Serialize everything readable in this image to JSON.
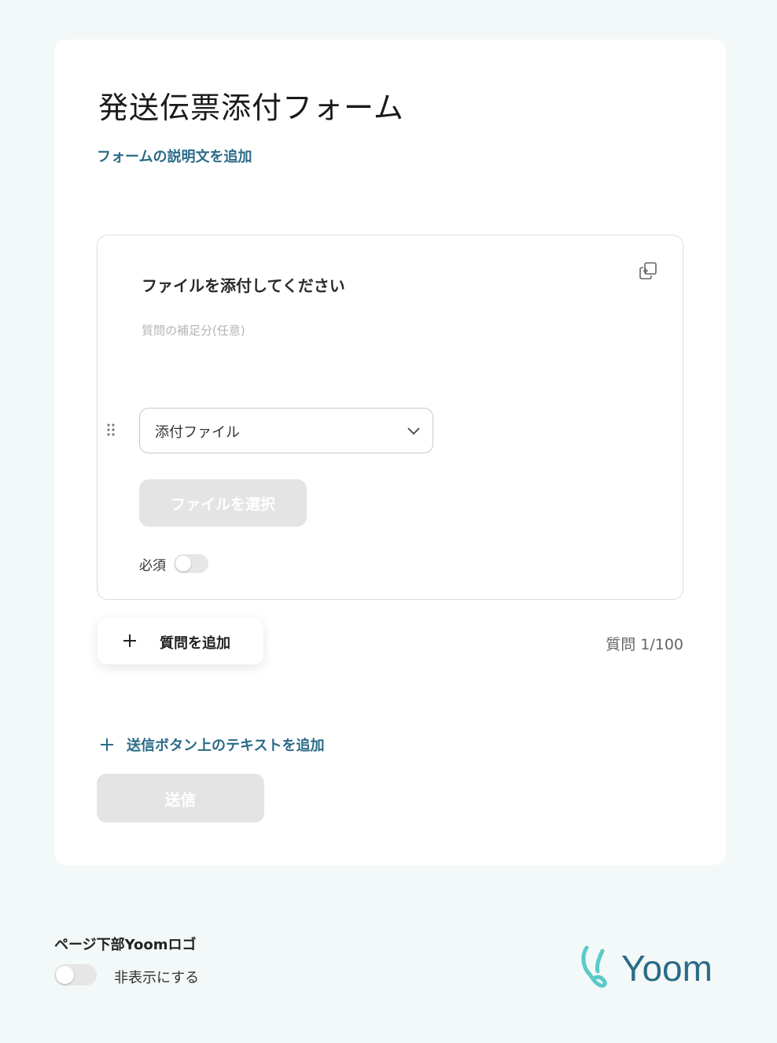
{
  "form": {
    "title": "発送伝票添付フォーム",
    "add_description": "フォームの説明文を追加"
  },
  "question": {
    "title": "ファイルを添付してください",
    "subtitle_placeholder": "質問の補足分(任意)",
    "type_selected": "添付ファイル",
    "file_button": "ファイルを選択",
    "required_label": "必須",
    "required_on": false
  },
  "actions": {
    "add_question": "質問を追加",
    "question_count": "質問 1/100",
    "add_submit_text": "送信ボタン上のテキストを追加",
    "submit": "送信"
  },
  "footer": {
    "logo_label": "ページ下部Yoomロゴ",
    "hide_label": "非表示にする",
    "hide_on": false,
    "logo_text": "Yoom"
  },
  "colors": {
    "accent": "#2b6b87",
    "background": "#f3f8f8",
    "disabled_button": "#e4e4e4",
    "logo_teal": "#5cc9c9",
    "logo_text": "#2b6b87"
  },
  "icons": {
    "copy": "duplicate-icon",
    "drag": "drag-handle-icon",
    "chevron": "chevron-down-icon",
    "plus": "plus-icon"
  }
}
